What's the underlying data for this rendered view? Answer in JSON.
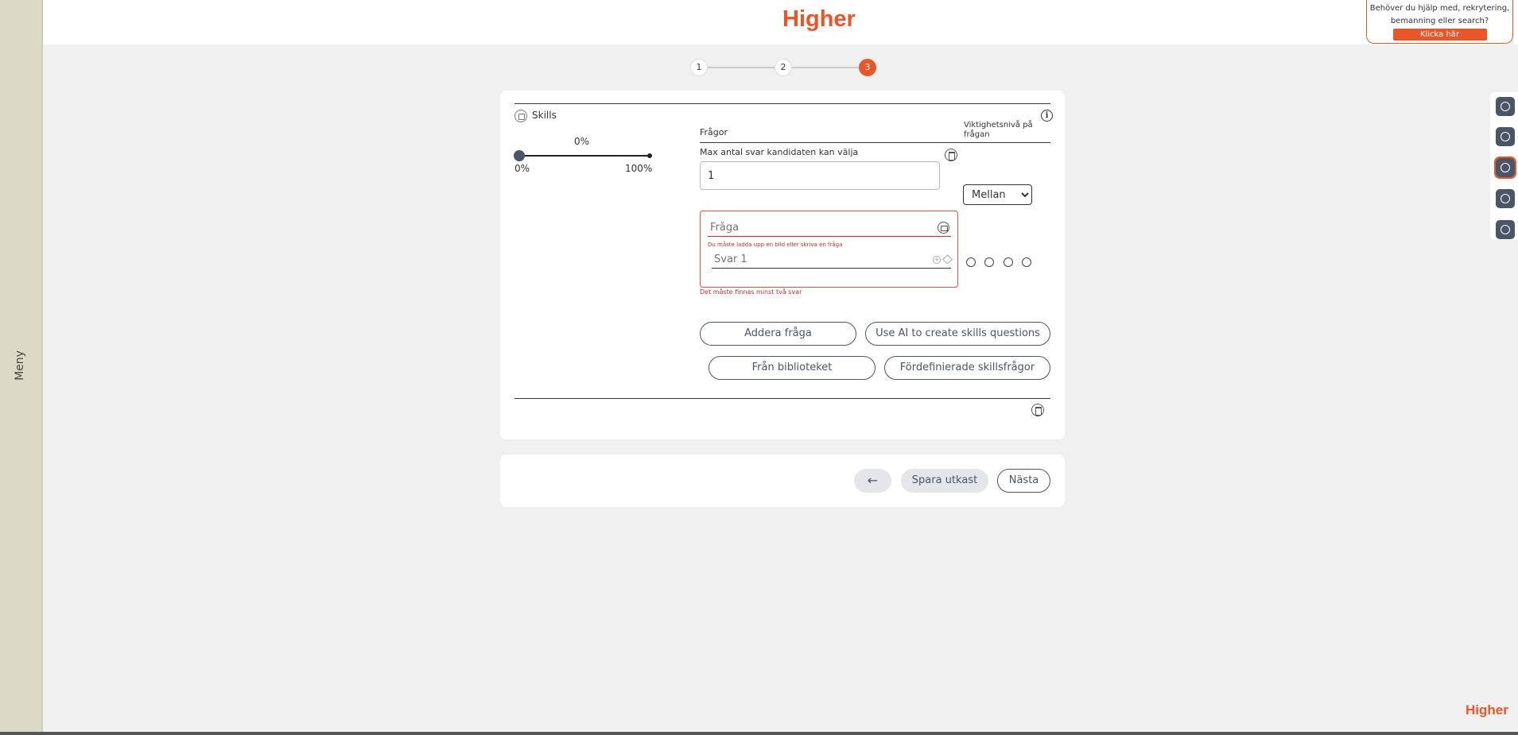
{
  "sidebar": {
    "label": "Meny"
  },
  "header": {
    "logo": "Higher"
  },
  "help": {
    "text": "Behöver du hjälp med, rekrytering, bemanning eller search?",
    "button": "Klicka här"
  },
  "stepper": {
    "steps": [
      "1",
      "2",
      "3"
    ],
    "active": "3"
  },
  "skills": {
    "title": "Skills",
    "info_icon": "i",
    "slider": {
      "value": "0%",
      "min_label": "0%",
      "max_label": "100%",
      "fraction": 0
    },
    "questions_header": "Frågor",
    "importance_header": "Viktighetsnivå på frågan",
    "max_answers_label": "Max antal svar kandidaten kan välja",
    "max_answers_value": "1",
    "importance_selected": "Mellan",
    "question_placeholder": "Fråga",
    "question_error": "Du måste ladda upp en bild eller skriva en fråga",
    "answer_placeholder": "Svar 1",
    "add_answer_icon": "+",
    "answers_error": "Det måste finnas minst två svar",
    "buttons": {
      "add_question": "Addera fråga",
      "ai_questions": "Use AI to create skills questions",
      "from_library": "Från biblioteket",
      "predefined": "Fördefinierade skillsfrågor"
    }
  },
  "nav": {
    "back_icon": "←",
    "save_draft": "Spara utkast",
    "next": "Nästa"
  },
  "rail": {
    "icons": [
      "profile-icon",
      "link-icon",
      "skills-icon",
      "heart-icon",
      "play-icon"
    ],
    "active": 2
  },
  "corner_logo": "Higher",
  "colors": {
    "brand": "#e8572a",
    "error": "#c9302c",
    "slate": "#4a5568"
  }
}
